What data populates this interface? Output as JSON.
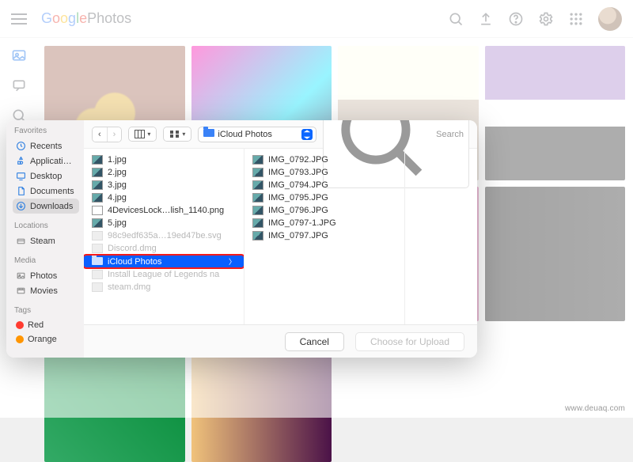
{
  "gp": {
    "brand_first": "Google",
    "brand_second": " Photos"
  },
  "finder": {
    "sidebar": {
      "favorites_h": "Favorites",
      "favorites": [
        {
          "label": "Recents",
          "icon": "clock"
        },
        {
          "label": "Applicati…",
          "icon": "app"
        },
        {
          "label": "Desktop",
          "icon": "desktop"
        },
        {
          "label": "Documents",
          "icon": "doc"
        },
        {
          "label": "Downloads",
          "icon": "download",
          "selected": true
        }
      ],
      "locations_h": "Locations",
      "locations": [
        {
          "label": "Steam",
          "icon": "drive"
        }
      ],
      "media_h": "Media",
      "media": [
        {
          "label": "Photos",
          "icon": "photos"
        },
        {
          "label": "Movies",
          "icon": "movies"
        }
      ],
      "tags_h": "Tags",
      "tags": [
        {
          "label": "Red",
          "color": "#ff3b30"
        },
        {
          "label": "Orange",
          "color": "#ff9500"
        }
      ]
    },
    "toolbar": {
      "location": "iCloud Photos",
      "search_placeholder": "Search"
    },
    "col1": [
      {
        "name": "1.jpg",
        "type": "img"
      },
      {
        "name": "2.jpg",
        "type": "img"
      },
      {
        "name": "3.jpg",
        "type": "img"
      },
      {
        "name": "4.jpg",
        "type": "img"
      },
      {
        "name": "4DevicesLock…lish_1140.png",
        "type": "png"
      },
      {
        "name": "5.jpg",
        "type": "img"
      },
      {
        "name": "98c9edf635a…19ed47be.svg",
        "type": "dim"
      },
      {
        "name": "Discord.dmg",
        "type": "dim"
      },
      {
        "name": "iCloud Photos",
        "type": "folder",
        "selected": true,
        "highlight": true
      },
      {
        "name": "Install League of Legends na",
        "type": "dim"
      },
      {
        "name": "steam.dmg",
        "type": "dim"
      }
    ],
    "col2": [
      {
        "name": "IMG_0792.JPG",
        "type": "img"
      },
      {
        "name": "IMG_0793.JPG",
        "type": "img"
      },
      {
        "name": "IMG_0794.JPG",
        "type": "img"
      },
      {
        "name": "IMG_0795.JPG",
        "type": "img"
      },
      {
        "name": "IMG_0796.JPG",
        "type": "img"
      },
      {
        "name": "IMG_0797-1.JPG",
        "type": "img"
      },
      {
        "name": "IMG_0797.JPG",
        "type": "img"
      }
    ],
    "footer": {
      "cancel": "Cancel",
      "choose": "Choose for Upload"
    }
  },
  "watermark": "www.deuaq.com"
}
